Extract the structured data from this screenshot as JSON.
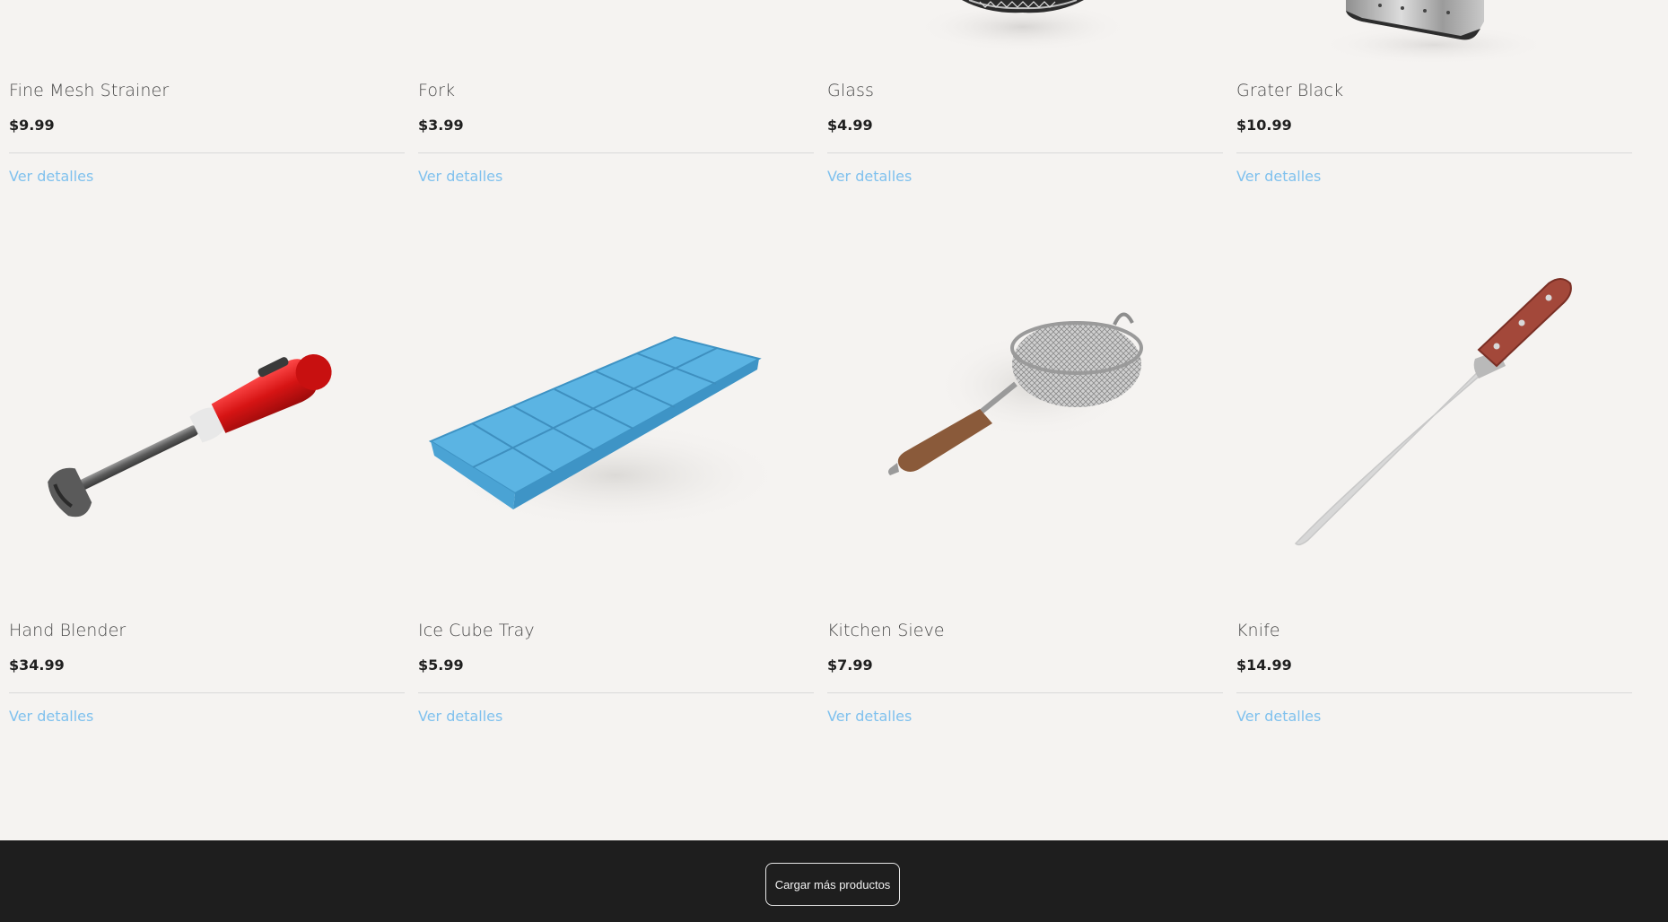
{
  "products_row1": [
    {
      "name": "Fine Mesh Strainer",
      "price": "$9.99",
      "details_label": "Ver detalles",
      "image": "fine-mesh-strainer-image"
    },
    {
      "name": "Fork",
      "price": "$3.99",
      "details_label": "Ver detalles",
      "image": "fork-image"
    },
    {
      "name": "Glass",
      "price": "$4.99",
      "details_label": "Ver detalles",
      "image": "glass-image"
    },
    {
      "name": "Grater Black",
      "price": "$10.99",
      "details_label": "Ver detalles",
      "image": "grater-black-image"
    }
  ],
  "products_row2": [
    {
      "name": "Hand Blender",
      "price": "$34.99",
      "details_label": "Ver detalles",
      "image": "hand-blender-image"
    },
    {
      "name": "Ice Cube Tray",
      "price": "$5.99",
      "details_label": "Ver detalles",
      "image": "ice-cube-tray-image"
    },
    {
      "name": "Kitchen Sieve",
      "price": "$7.99",
      "details_label": "Ver detalles",
      "image": "kitchen-sieve-image"
    },
    {
      "name": "Knife",
      "price": "$14.99",
      "details_label": "Ver detalles",
      "image": "knife-image"
    }
  ],
  "footer": {
    "load_more_label": "Cargar más productos"
  },
  "colors": {
    "background": "#f5f3f1",
    "link": "#7fc1ee",
    "footer": "#1e1e1e",
    "price": "#1f1f1f",
    "name": "#4a4a4a"
  }
}
